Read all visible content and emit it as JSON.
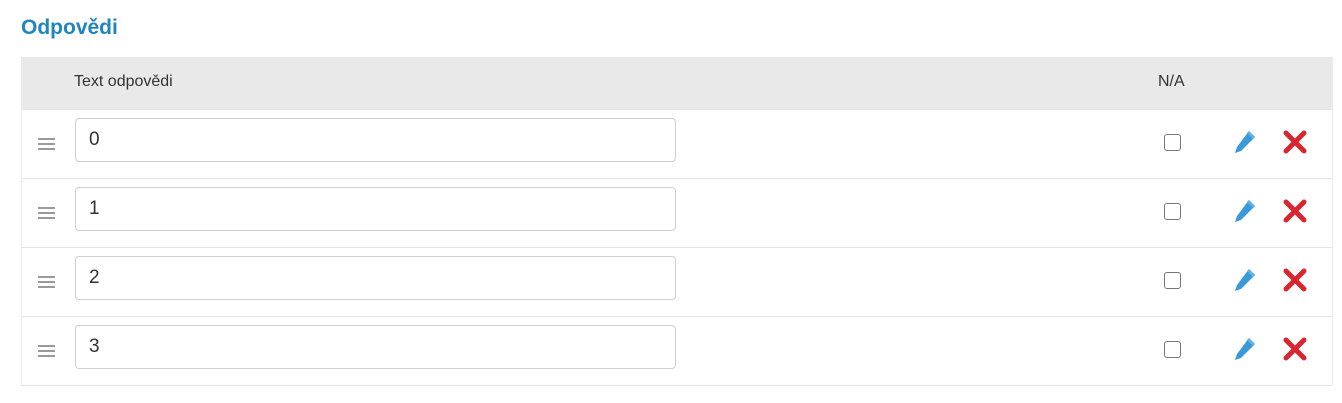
{
  "section": {
    "title": "Odpovědi"
  },
  "table": {
    "headers": {
      "text": "Text odpovědi",
      "na": "N/A"
    },
    "rows": [
      {
        "value": "0",
        "na_checked": false
      },
      {
        "value": "1",
        "na_checked": false
      },
      {
        "value": "2",
        "na_checked": false
      },
      {
        "value": "3",
        "na_checked": false
      }
    ]
  },
  "icons": {
    "drag": "drag-handle-icon",
    "edit": "pencil-icon",
    "delete": "close-icon"
  },
  "colors": {
    "title": "#1f86c1",
    "edit_icon": "#3a9ad9",
    "delete_icon": "#d9252f",
    "header_bg": "#e9e9e9"
  }
}
